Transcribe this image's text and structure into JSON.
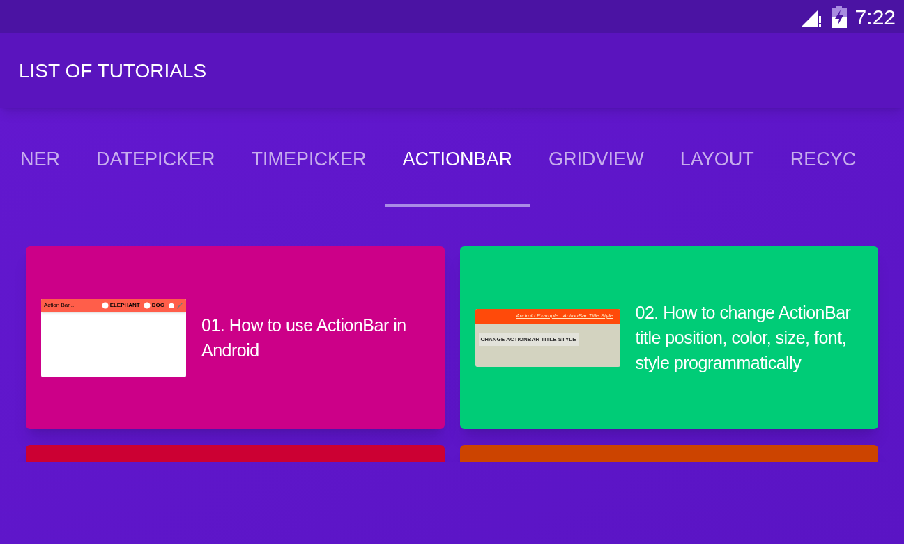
{
  "status_bar": {
    "time": "7:22"
  },
  "app_bar": {
    "title": "LIST OF TUTORIALS"
  },
  "tabs": [
    {
      "label": "NER",
      "selected": false
    },
    {
      "label": "DATEPICKER",
      "selected": false
    },
    {
      "label": "TIMEPICKER",
      "selected": false
    },
    {
      "label": "ACTIONBAR",
      "selected": true
    },
    {
      "label": "GRIDVIEW",
      "selected": false
    },
    {
      "label": "LAYOUT",
      "selected": false
    },
    {
      "label": "RECYC",
      "selected": false
    }
  ],
  "cards": [
    {
      "color": "#cc0088",
      "title": "01. How to use ActionBar in Android",
      "preview": {
        "kind": "menu",
        "bar_title": "Action Bar...",
        "items": [
          "ELEPHANT",
          "DOG"
        ]
      }
    },
    {
      "color": "#00cc77",
      "title": "02. How to change ActionBar title position, color, size, font, style programmatically",
      "preview": {
        "kind": "button",
        "bar_title": "Android Example : ActionBar Title Style",
        "button": "CHANGE ACTIONBAR TITLE STYLE"
      }
    },
    {
      "color": "#cc0033"
    },
    {
      "color": "#cc4400"
    }
  ]
}
